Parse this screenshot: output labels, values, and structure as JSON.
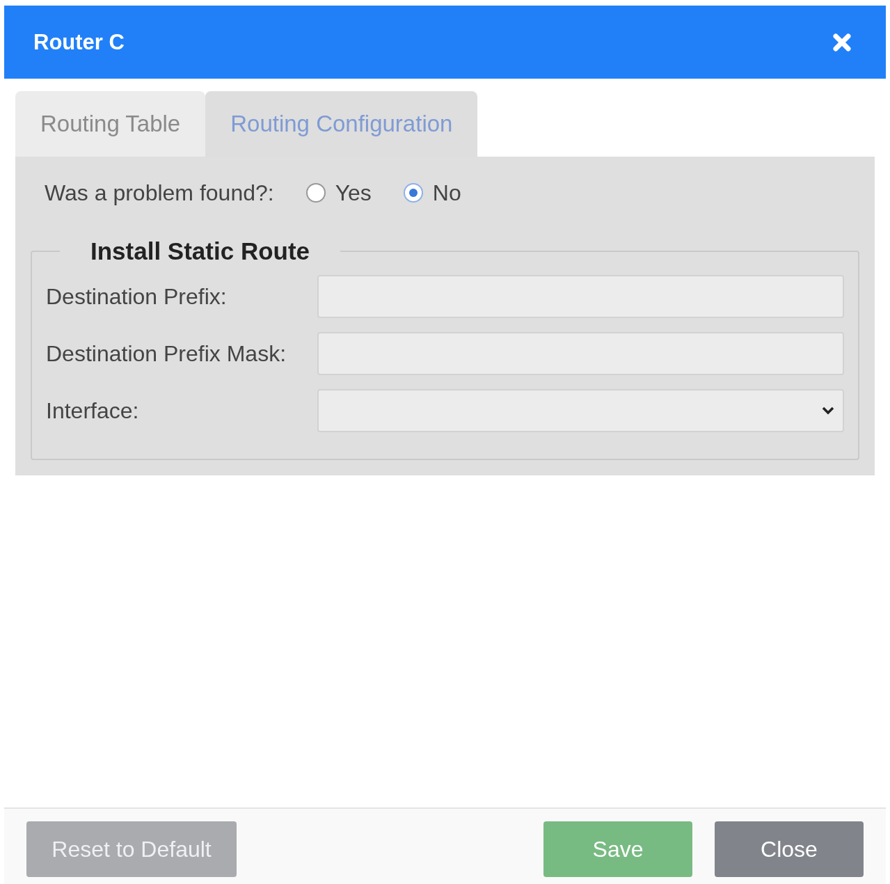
{
  "window": {
    "title": "Router C"
  },
  "tabs": [
    {
      "label": "Routing Table",
      "selected": false
    },
    {
      "label": "Routing Configuration",
      "selected": true
    }
  ],
  "problem_question": {
    "label": "Was a problem found?:",
    "options": [
      {
        "label": "Yes",
        "selected": false
      },
      {
        "label": "No",
        "selected": true
      }
    ]
  },
  "static_route": {
    "legend": "Install Static Route",
    "fields": [
      {
        "kind": "text",
        "label": "Destination Prefix:"
      },
      {
        "kind": "text",
        "label": "Destination Prefix Mask:"
      },
      {
        "kind": "select",
        "label": "Interface:"
      }
    ]
  },
  "buttons": [
    {
      "label": "Reset to Default",
      "kind": "reset",
      "disabled": true
    },
    {
      "label": "Save",
      "kind": "save",
      "disabled": false
    },
    {
      "label": "Close",
      "kind": "close",
      "disabled": false
    }
  ]
}
